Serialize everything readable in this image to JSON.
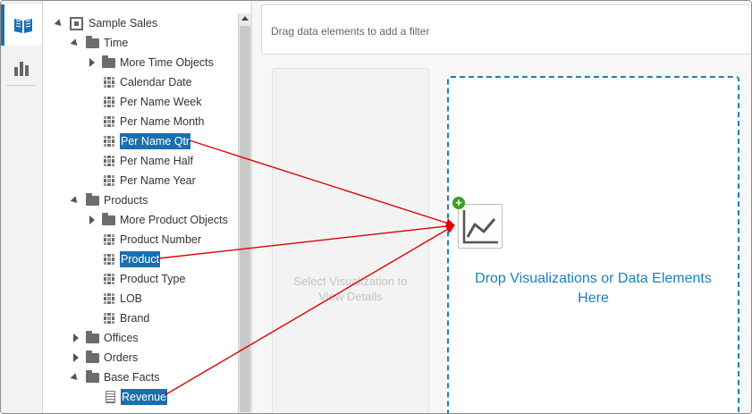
{
  "tabs": [
    {
      "icon": "book-icon",
      "active": true
    },
    {
      "icon": "bar-chart-icon",
      "active": false
    }
  ],
  "tree": {
    "root": "Sample Sales",
    "time_folder": "Time",
    "more_time": "More Time Objects",
    "calendar_date": "Calendar Date",
    "per_name_week": "Per Name Week",
    "per_name_month": "Per Name Month",
    "per_name_qtr": "Per Name Qtr",
    "per_name_half": "Per Name Half",
    "per_name_year": "Per Name Year",
    "products_folder": "Products",
    "more_product": "More Product Objects",
    "product_number": "Product Number",
    "product": "Product",
    "product_type": "Product Type",
    "lob": "LOB",
    "brand": "Brand",
    "offices_folder": "Offices",
    "orders_folder": "Orders",
    "base_facts_folder": "Base Facts",
    "revenue": "Revenue"
  },
  "canvas": {
    "filter_hint": "Drag data elements to add a filter",
    "viz_details_hint": "Select Visualization to View Details",
    "drop_hint_line1": "Drop Visualizations or Data Elements",
    "drop_hint_line2": "Here"
  },
  "colors": {
    "accent": "#1a6fae",
    "drop_border": "#1a80bd",
    "arrow": "#e00000",
    "plus": "#3a9d23"
  }
}
